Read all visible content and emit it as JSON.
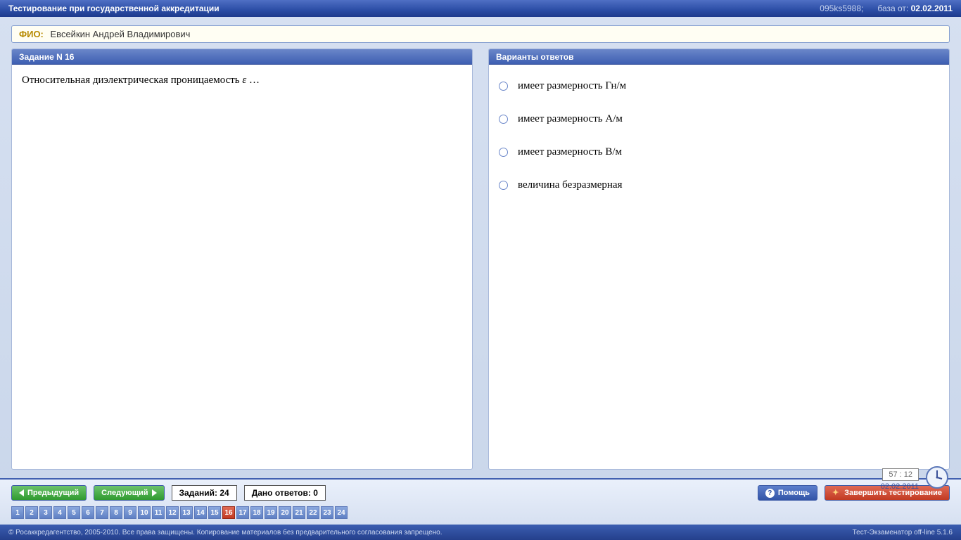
{
  "title_bar": {
    "title": "Тестирование при государственной аккредитации",
    "session_id": "095ks5988;",
    "db_label": "база от:",
    "db_date": "02.02.2011"
  },
  "fio": {
    "label": "ФИО:",
    "name": "Евсейкин Андрей Владимирович"
  },
  "question_pane": {
    "header": "Задание N 16",
    "text_pre": "Относительная диэлектрическая проницаемость ",
    "symbol": "ε",
    "text_post": "  …"
  },
  "answers_pane": {
    "header": "Варианты ответов",
    "options": [
      "имеет размерность Гн/м",
      "имеет размерность А/м",
      "имеет размерность В/м",
      "величина безразмерная"
    ]
  },
  "nav": {
    "prev": "Предыдущий",
    "next": "Следующий",
    "total_label": "Заданий: 24",
    "answered_label": "Дано ответов: 0",
    "help": "Помощь",
    "finish": "Завершить тестирование",
    "count": 24,
    "current": 16
  },
  "clock": {
    "time": "57 : 12",
    "date": "02.02.2011"
  },
  "footer": {
    "left": "© Росаккредагентство, 2005-2010. Все права защищены. Копирование материалов без предварительного согласования запрещено.",
    "right": "Тест-Экзаменатор off-line 5.1.6"
  }
}
